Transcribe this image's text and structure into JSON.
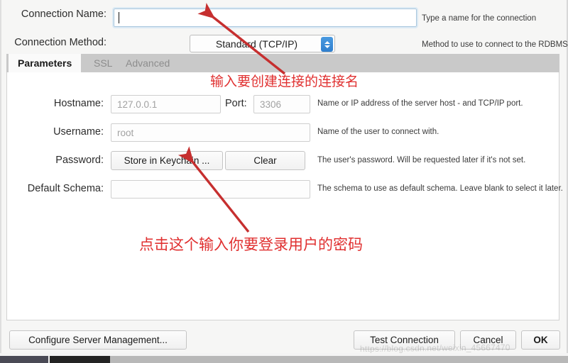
{
  "dialog": {
    "connection_name": {
      "label": "Connection Name:",
      "value": "",
      "placeholder": "",
      "help": "Type a name for the connection"
    },
    "connection_method": {
      "label": "Connection Method:",
      "selected": "Standard (TCP/IP)",
      "help": "Method to use to connect to the RDBMS"
    },
    "tabs": [
      {
        "label": "Parameters",
        "active": true
      },
      {
        "label": "SSL",
        "active": false
      },
      {
        "label": "Advanced",
        "active": false
      }
    ],
    "parameters": {
      "hostname": {
        "label": "Hostname:",
        "value": "127.0.0.1",
        "port_label": "Port:",
        "port_value": "3306",
        "help": "Name or IP address of the server host - and TCP/IP port."
      },
      "username": {
        "label": "Username:",
        "value": "root",
        "help": "Name of the user to connect with."
      },
      "password": {
        "label": "Password:",
        "store_button": "Store in Keychain ...",
        "clear_button": "Clear",
        "help": "The user's password. Will be requested later if it's not set."
      },
      "default_schema": {
        "label": "Default Schema:",
        "value": "",
        "help": "The schema to use as default schema. Leave blank to select it later."
      }
    },
    "footer": {
      "configure_server": "Configure Server Management...",
      "test_connection": "Test Connection",
      "cancel": "Cancel",
      "ok": "OK"
    }
  },
  "annotations": {
    "note_top": "输入要创建连接的连接名",
    "note_bottom": "点击这个输入你要登录用户的密码",
    "color": "#e03030"
  },
  "watermark": "https://blog.csdn.net/weixin_45667470",
  "colors": {
    "accent_blue": "#2f7fce",
    "focus_border": "#a9c6dd",
    "tab_strip": "#c9c9c9",
    "dialog_bg": "#f6f6f5",
    "annotation_red": "#e03030"
  }
}
